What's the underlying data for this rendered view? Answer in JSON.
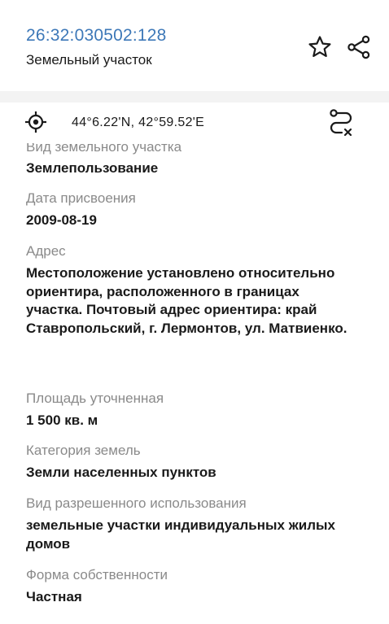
{
  "header": {
    "cadastral_number": "26:32:030502:128",
    "object_type": "Земельный участок"
  },
  "coordinates": {
    "text": "44°6.22'N, 42°59.52'E"
  },
  "fields": [
    {
      "label": "Вид земельного участка",
      "value": "Землепользование"
    },
    {
      "label": "Дата присвоения",
      "value": "2009-08-19"
    },
    {
      "label": "Адрес",
      "value": "Местоположение установлено относительно ориентира, расположенного в границах участка. Почтовый адрес ориентира: край Ставропольский, г. Лермонтов, ул. Матвиенко."
    },
    {
      "label": "Площадь уточненная",
      "value": "1 500 кв. м"
    },
    {
      "label": "Категория земель",
      "value": "Земли населенных пунктов"
    },
    {
      "label": "Вид разрешенного использования",
      "value": "земельные участки индивидуальных жилых домов"
    },
    {
      "label": "Форма собственности",
      "value": "Частная"
    }
  ],
  "icons": {
    "favorite": "star-icon",
    "share": "share-icon",
    "location": "target-icon",
    "route": "route-icon"
  },
  "colors": {
    "accent": "#3d78b8",
    "label": "#8a8a8a",
    "text": "#1a1a1a"
  }
}
